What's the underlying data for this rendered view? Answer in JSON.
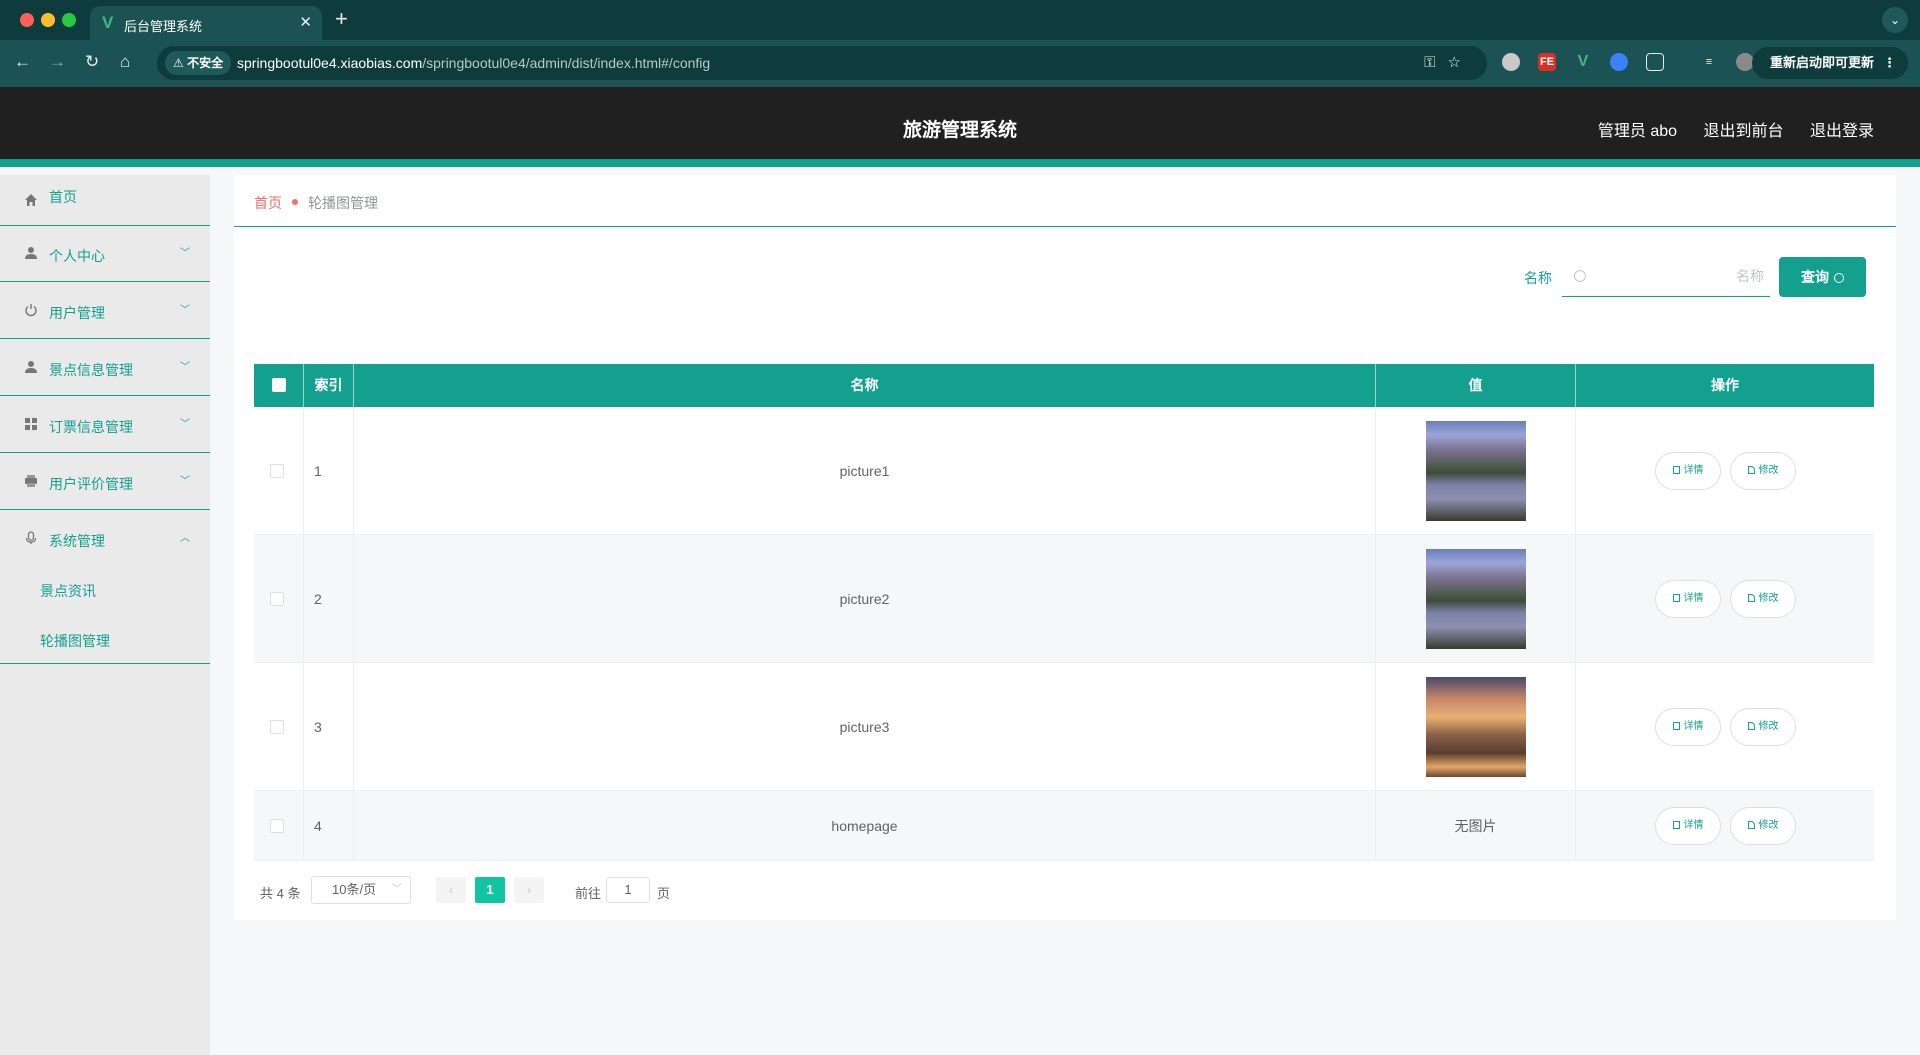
{
  "browser": {
    "tab_title": "后台管理系统",
    "tab_favicon": "V",
    "close_glyph": "✕",
    "newtab_glyph": "+",
    "security_label": "⚠ 不安全",
    "url_host": "springbootul0e4.xiaobias.com",
    "url_path": "/springbootul0e4/admin/dist/index.html#/config",
    "relaunch_label": "重新启动即可更新",
    "extensions": [
      "FE",
      "V"
    ]
  },
  "header": {
    "title": "旅游管理系统",
    "admin_label": "管理员 abo",
    "to_front_label": "退出到前台",
    "logout_label": "退出登录"
  },
  "sidebar": {
    "items": [
      {
        "label": "首页",
        "icon": "home-icon"
      },
      {
        "label": "个人中心",
        "icon": "user-icon"
      },
      {
        "label": "用户管理",
        "icon": "power-icon"
      },
      {
        "label": "景点信息管理",
        "icon": "user-icon"
      },
      {
        "label": "订票信息管理",
        "icon": "grid-icon"
      },
      {
        "label": "用户评价管理",
        "icon": "printer-icon"
      },
      {
        "label": "系统管理",
        "icon": "mic-icon"
      }
    ],
    "subitems": [
      "景点资讯",
      "轮播图管理"
    ]
  },
  "breadcrumb": {
    "home": "首页",
    "current": "轮播图管理"
  },
  "search": {
    "label": "名称",
    "placeholder": "名称",
    "value": "",
    "button_label": "查询"
  },
  "table": {
    "columns": [
      "索引",
      "名称",
      "值",
      "操作"
    ],
    "rows": [
      {
        "index": "1",
        "name": "picture1",
        "value": "image",
        "thumb": "mountain-lake"
      },
      {
        "index": "2",
        "name": "picture2",
        "value": "image",
        "thumb": "mountain-lake"
      },
      {
        "index": "3",
        "name": "picture3",
        "value": "image",
        "thumb": "town-sunset"
      },
      {
        "index": "4",
        "name": "homepage",
        "value": "无图片",
        "thumb": ""
      }
    ],
    "detail_label": "详情",
    "edit_label": "修改"
  },
  "pagination": {
    "total_text": "共 4 条",
    "page_size": "10条/页",
    "current_page": "1",
    "goto_label": "前往",
    "goto_value": "1",
    "page_unit": "页"
  },
  "colors": {
    "accent": "#13a08f",
    "header_bg": "#202020",
    "danger": "#f56c6c"
  }
}
